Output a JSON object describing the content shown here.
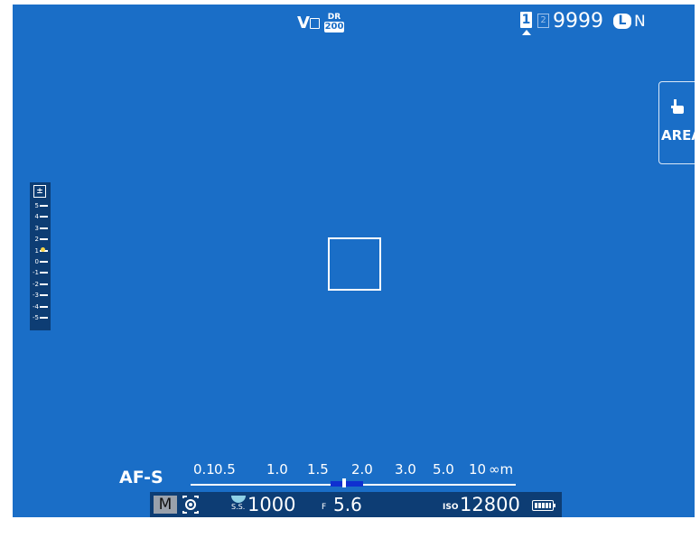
{
  "screen": {
    "background": "#1a6ec7"
  },
  "top_center": {
    "film_sim": "V",
    "dr_label": "DR",
    "dr_value": "200"
  },
  "top_right": {
    "slot1": "1",
    "slot2": "2",
    "frames_remaining": "9999",
    "image_size": "L",
    "image_quality": "N"
  },
  "area_button": {
    "label": "AREA",
    "icon": "touch-hand-icon"
  },
  "exposure_scale": {
    "icon": "exposure-compensation-icon",
    "ticks": [
      "5",
      "4",
      "3",
      "2",
      "1",
      "0",
      "-1",
      "-2",
      "-3",
      "-4",
      "-5"
    ],
    "current": 1,
    "marker_color": "#f5d44a"
  },
  "focus_mode": "AF-S",
  "distance_scale": {
    "labels": [
      "0.1",
      "0.5",
      "1.0",
      "1.5",
      "2.0",
      "3.0",
      "5.0",
      "10",
      "∞m"
    ],
    "range_color": "#0f2fd0"
  },
  "info_bar": {
    "mode": "M",
    "metering_icon": "multi-metering-icon",
    "ss_label": "S.S.",
    "shutter_speed": "1000",
    "f_label": "F",
    "aperture": "5.6",
    "iso_label": "ISO",
    "iso": "12800",
    "battery_icon": "battery-full-icon"
  }
}
